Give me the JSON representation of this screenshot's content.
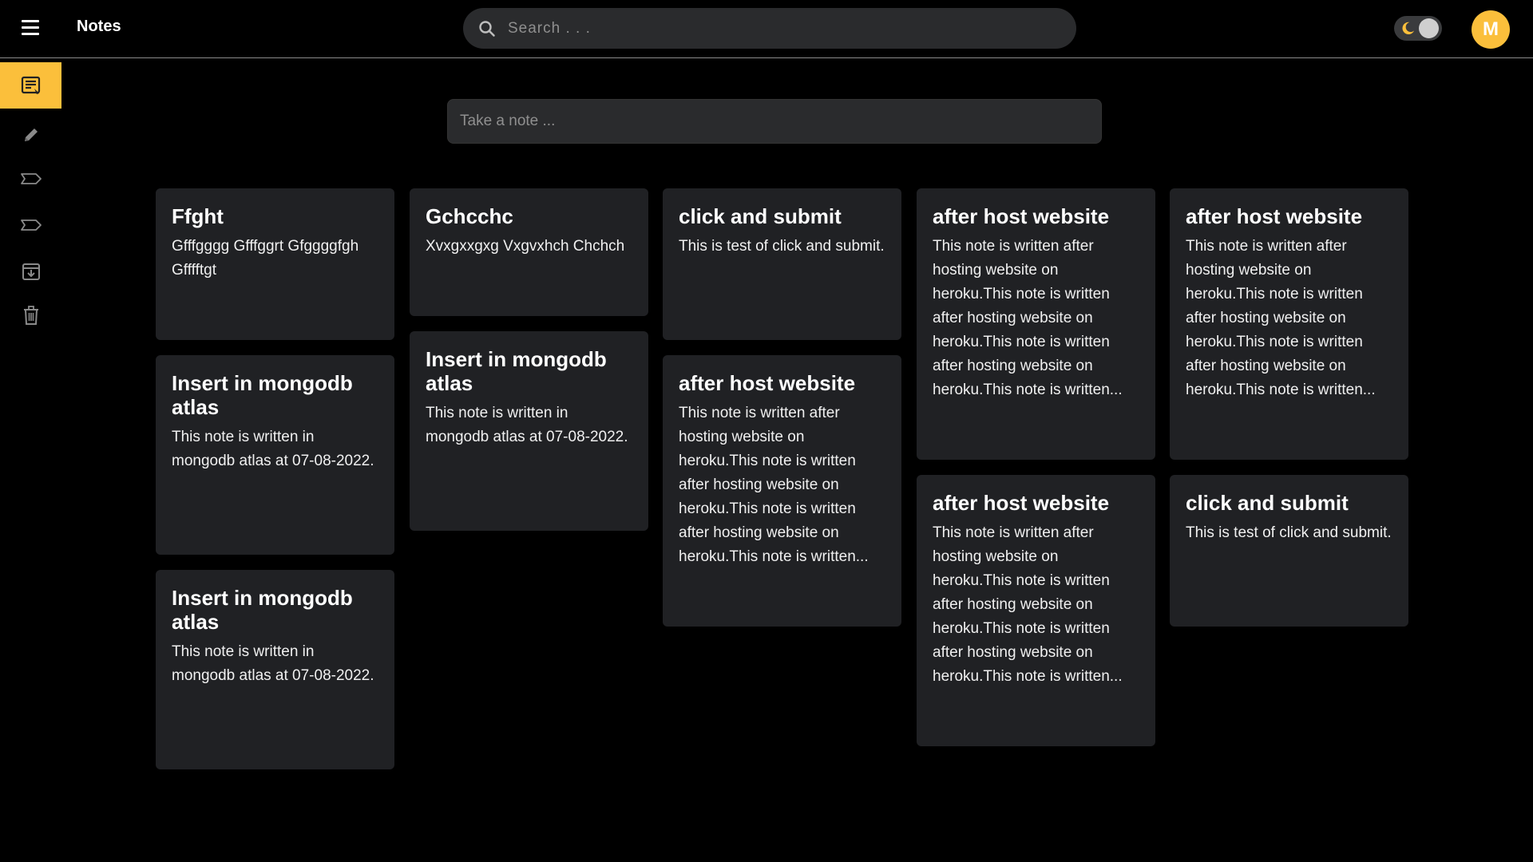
{
  "header": {
    "title": "Notes",
    "search_placeholder": "Search . . .",
    "avatar_initial": "M"
  },
  "composer": {
    "placeholder": "Take a note ..."
  },
  "sidebar": {
    "items": [
      {
        "icon": "notes-icon",
        "active": true
      },
      {
        "icon": "pencil-icon",
        "active": false
      },
      {
        "icon": "label-icon",
        "active": false
      },
      {
        "icon": "label-icon",
        "active": false
      },
      {
        "icon": "archive-icon",
        "active": false
      },
      {
        "icon": "trash-icon",
        "active": false
      }
    ]
  },
  "colors": {
    "accent": "#fbbf3b",
    "card": "#202124",
    "input": "#2a2b2d",
    "background": "#000000"
  },
  "notes": [
    {
      "title": "Ffght",
      "body": "Gfffgggg Gfffggrt Gfggggfgh Gfffftgt"
    },
    {
      "title": "Gchcchc",
      "body": "Xvxgxxgxg Vxgvxhch Chchch"
    },
    {
      "title": "click and submit",
      "body": "This is test of click and submit."
    },
    {
      "title": "after host website",
      "body": "This note is written after hosting website on heroku.This note is written after hosting website on heroku.This note is written after hosting website on heroku.This note is written..."
    },
    {
      "title": "after host website",
      "body": "This note is written after hosting website on heroku.This note is written after hosting website on heroku.This note is written after hosting website on heroku.This note is written..."
    },
    {
      "title": "Insert in mongodb atlas",
      "body": "This note is written in mongodb atlas at 07-08-2022."
    },
    {
      "title": "Insert in mongodb atlas",
      "body": "This note is written in mongodb atlas at 07-08-2022."
    },
    {
      "title": "after host website",
      "body": "This note is written after hosting website on heroku.This note is written after hosting website on heroku.This note is written after hosting website on heroku.This note is written..."
    },
    {
      "title": "after host website",
      "body": "This note is written after hosting website on heroku.This note is written after hosting website on heroku.This note is written after hosting website on heroku.This note is written..."
    },
    {
      "title": "click and submit",
      "body": "This is test of click and submit."
    },
    {
      "title": "Insert in mongodb atlas",
      "body": "This note is written in mongodb atlas at 07-08-2022."
    }
  ]
}
